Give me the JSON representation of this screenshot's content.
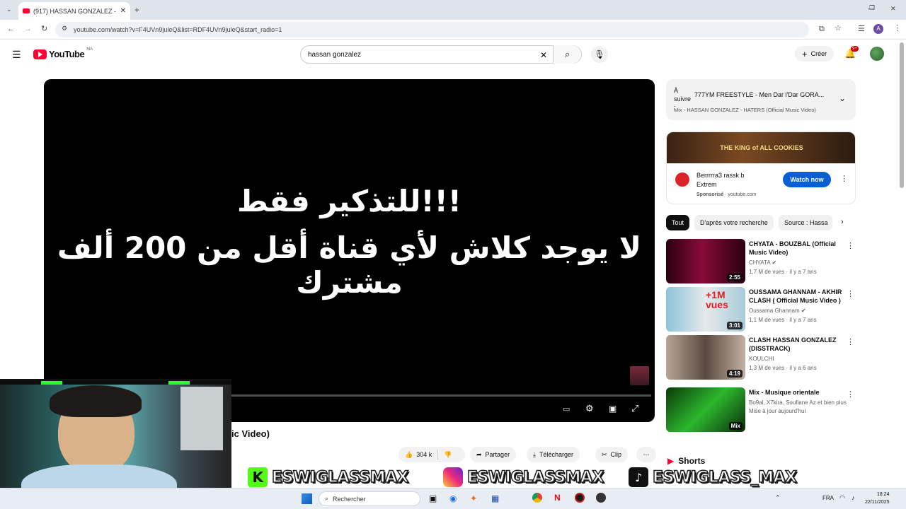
{
  "browser": {
    "tab_title": "(917) HASSAN GONZALEZ - HA",
    "url": "youtube.com/watch?v=F4UVn9juleQ&list=RDF4UVn9juleQ&start_radio=1",
    "new_tab_icon": "+"
  },
  "youtube": {
    "logo_text": "YouTube",
    "region": "MA",
    "search_value": "hassan gonzalez",
    "create_label": "Créer",
    "notif_badge": "9+"
  },
  "player": {
    "line1": "للتذكير فقط!!!",
    "line2": "لا يوجد كلاش لأي قناة أقل من 200 ألف مشترك"
  },
  "video": {
    "title_fragment": "ic Video)",
    "likes": "304 k",
    "share_label": "Partager",
    "download_label": "Télécharger",
    "clip_label": "Clip"
  },
  "up_next": {
    "label": "À suivre :",
    "title": "777YM FREESTYLE - Men Dar l'Dar GORA...",
    "subtitle": "Mix - HASSAN GONZALEZ - HATERS (Official Music Video)"
  },
  "ad": {
    "banner_text": "THE KING of ALL COOKIES",
    "title": "Berrrrra3 rassk b Extrem",
    "sponsored": "Sponsorisé",
    "domain": "youtube.com",
    "cta": "Watch now"
  },
  "chips": [
    "Tout",
    "D'après votre recherche",
    "Source : Hassa"
  ],
  "videos": [
    {
      "title": "CHYATA - BOUZBAL (Official Music Video)",
      "channel": "CHYATA",
      "meta": "1,7 M de vues · il y a 7 ans",
      "duration": "2:55",
      "verified": true
    },
    {
      "title": "OUSSAMA GHANNAM - AKHIR CLASH ( Official Music Video )",
      "channel": "Oussama Ghannam",
      "meta": "1,1 M de vues · il y a 7 ans",
      "duration": "3:01",
      "verified": true,
      "thumb_text": "+1M vues"
    },
    {
      "title": "CLASH HASSAN GONZALEZ (DISSTRACK)",
      "channel": "KOULCHI",
      "meta": "1,3 M de vues · il y a 6 ans",
      "duration": "4:19",
      "verified": false
    },
    {
      "title": "Mix - Musique orientale",
      "channel": "Bo9al, X7kira, Soufiane Az et bien plus e...",
      "meta": "Mise à jour aujourd'hui",
      "duration": "Mix",
      "verified": false
    }
  ],
  "shorts_label": "Shorts",
  "overlay": {
    "handle_kick": "ESWIGLASSMAX",
    "handle_instagram": "ESWIGLASSMAX",
    "handle_tiktok": "ESWIGLASS_MAX"
  },
  "taskbar": {
    "search_placeholder": "Rechercher",
    "lang": "FRA",
    "time": "18:24",
    "date": "22/11/2025"
  }
}
